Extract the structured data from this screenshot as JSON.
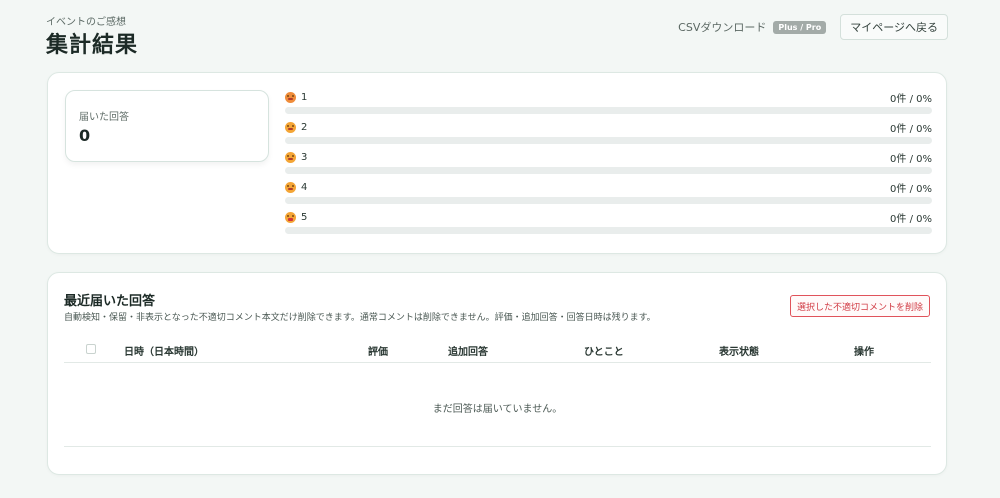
{
  "header": {
    "eyebrow": "イベントのご感想",
    "title": "集計結果",
    "csv_label": "CSVダウンロード",
    "plan_badge": "Plus / Pro",
    "mypage_label": "マイページへ戻る"
  },
  "summary": {
    "received_label": "届いた回答",
    "received_count": "0",
    "ratings": [
      {
        "label": "1",
        "value_text": "0件 / 0%",
        "percent": 0,
        "icon": "angry-face-icon"
      },
      {
        "label": "2",
        "value_text": "0件 / 0%",
        "percent": 0,
        "icon": "frowning-face-icon"
      },
      {
        "label": "3",
        "value_text": "0件 / 0%",
        "percent": 0,
        "icon": "neutral-face-icon"
      },
      {
        "label": "4",
        "value_text": "0件 / 0%",
        "percent": 0,
        "icon": "smiling-face-icon"
      },
      {
        "label": "5",
        "value_text": "0件 / 0%",
        "percent": 0,
        "icon": "grinning-face-icon"
      }
    ]
  },
  "responses": {
    "title": "最近届いた回答",
    "description": "自動検知・保留・非表示となった不適切コメント本文だけ削除できます。通常コメントは削除できません。評価・追加回答・回答日時は残ります。",
    "delete_label": "選択した不適切コメントを削除",
    "columns": {
      "datetime": "日時（日本時間）",
      "rating": "評価",
      "extra": "追加回答",
      "comment": "ひとこと",
      "status": "表示状態",
      "action": "操作"
    },
    "empty_message": "まだ回答は届いていません。"
  },
  "colors": {
    "background": "#f3f7f5",
    "danger": "#d13b44",
    "badge": "#a3aba8"
  }
}
